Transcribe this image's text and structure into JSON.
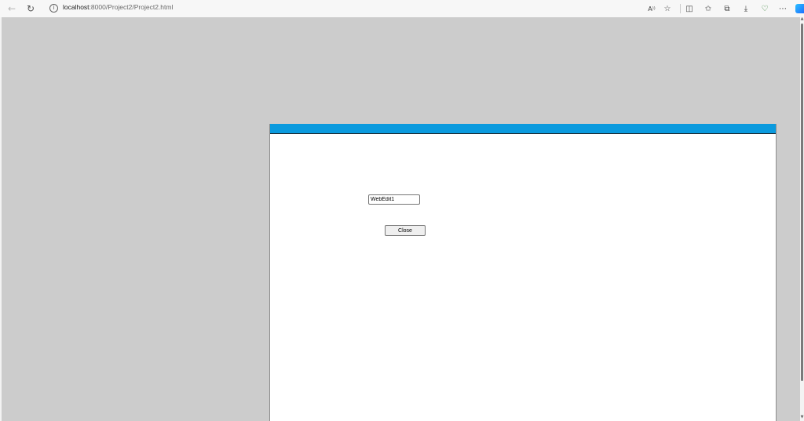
{
  "browser": {
    "url_host": "localhost",
    "url_path": ":8000/Project2/Project2.html",
    "icons": {
      "back": "back-arrow-icon",
      "refresh": "refresh-icon",
      "site_info": "info-icon",
      "read_aloud": "read-aloud-icon",
      "favorite": "star-icon",
      "split_screen": "split-screen-icon",
      "favorites": "favorites-icon",
      "collections": "collections-icon",
      "downloads": "download-icon",
      "browser_essentials": "heart-shield-icon",
      "settings_more": "more-icon",
      "copilot": "copilot-icon"
    }
  },
  "page": {
    "background_color": "#cccccc",
    "form": {
      "caption_color": "#0a9ade",
      "edit": {
        "value": "WebEdit1"
      },
      "close_button": {
        "label": "Close"
      }
    }
  }
}
